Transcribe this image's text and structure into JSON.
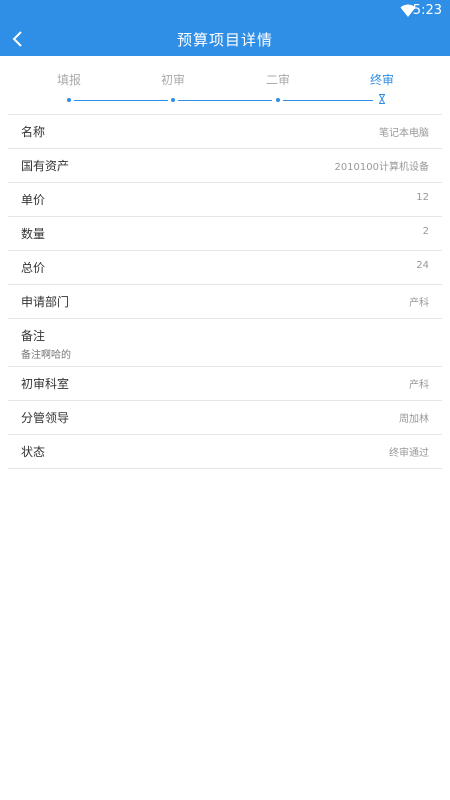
{
  "status_bar": {
    "time": "5:23",
    "wifi_icon": "wifi-icon"
  },
  "header": {
    "title": "预算项目详情",
    "back_icon": "chevron-left-icon"
  },
  "steps": [
    {
      "label": "填报",
      "done": true
    },
    {
      "label": "初审",
      "done": true
    },
    {
      "label": "二审",
      "done": true
    },
    {
      "label": "终审",
      "done": false,
      "current": true
    }
  ],
  "details": [
    {
      "label": "名称",
      "value": "笔记本电脑"
    },
    {
      "label": "国有资产",
      "value": "2010100计算机设备"
    },
    {
      "label": "单价",
      "value": "12"
    },
    {
      "label": "数量",
      "value": "2"
    },
    {
      "label": "总价",
      "value": "24"
    },
    {
      "label": "申请部门",
      "value": "产科"
    },
    {
      "label": "备注",
      "value": "备注啊哈的"
    },
    {
      "label": "初审科室",
      "value": "产科"
    },
    {
      "label": "分管领导",
      "value": "周加林"
    },
    {
      "label": "状态",
      "value": "终审通过"
    }
  ],
  "colors": {
    "primary": "#2f8ee6",
    "divider": "#e6e6e6",
    "muted": "#999999"
  }
}
